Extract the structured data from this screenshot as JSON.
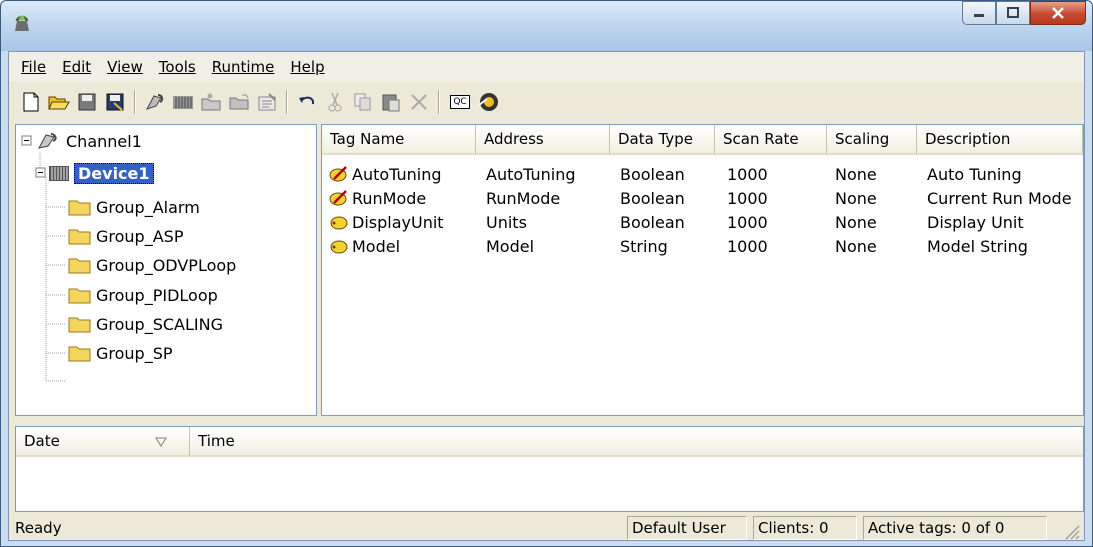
{
  "menu": [
    "File",
    "Edit",
    "View",
    "Tools",
    "Runtime",
    "Help"
  ],
  "toolbar": {
    "qc_label": "QC"
  },
  "tree": {
    "channel": "Channel1",
    "device": "Device1",
    "groups": [
      "Group_Alarm",
      "Group_ASP",
      "Group_ODVPLoop",
      "Group_PIDLoop",
      "Group_SCALING",
      "Group_SP"
    ]
  },
  "grid": {
    "columns": [
      "Tag Name",
      "Address",
      "Data Type",
      "Scan Rate",
      "Scaling",
      "Description"
    ],
    "rows": [
      {
        "tag": "AutoTuning",
        "address": "AutoTuning",
        "type": "Boolean",
        "rate": "1000",
        "scaling": "None",
        "desc": "Auto Tuning",
        "icon": "pencil-tag-icon"
      },
      {
        "tag": "RunMode",
        "address": "RunMode",
        "type": "Boolean",
        "rate": "1000",
        "scaling": "None",
        "desc": "Current Run Mode",
        "icon": "pencil-tag-icon"
      },
      {
        "tag": "DisplayUnit",
        "address": "Units",
        "type": "Boolean",
        "rate": "1000",
        "scaling": "None",
        "desc": "Display Unit",
        "icon": "tag-icon"
      },
      {
        "tag": "Model",
        "address": "Model",
        "type": "String",
        "rate": "1000",
        "scaling": "None",
        "desc": "Model String",
        "icon": "tag-icon"
      }
    ]
  },
  "log": {
    "columns": [
      "Date",
      "Time"
    ]
  },
  "status": {
    "ready": "Ready",
    "user": "Default User",
    "clients": "Clients: 0",
    "active": "Active tags: 0 of 0"
  }
}
